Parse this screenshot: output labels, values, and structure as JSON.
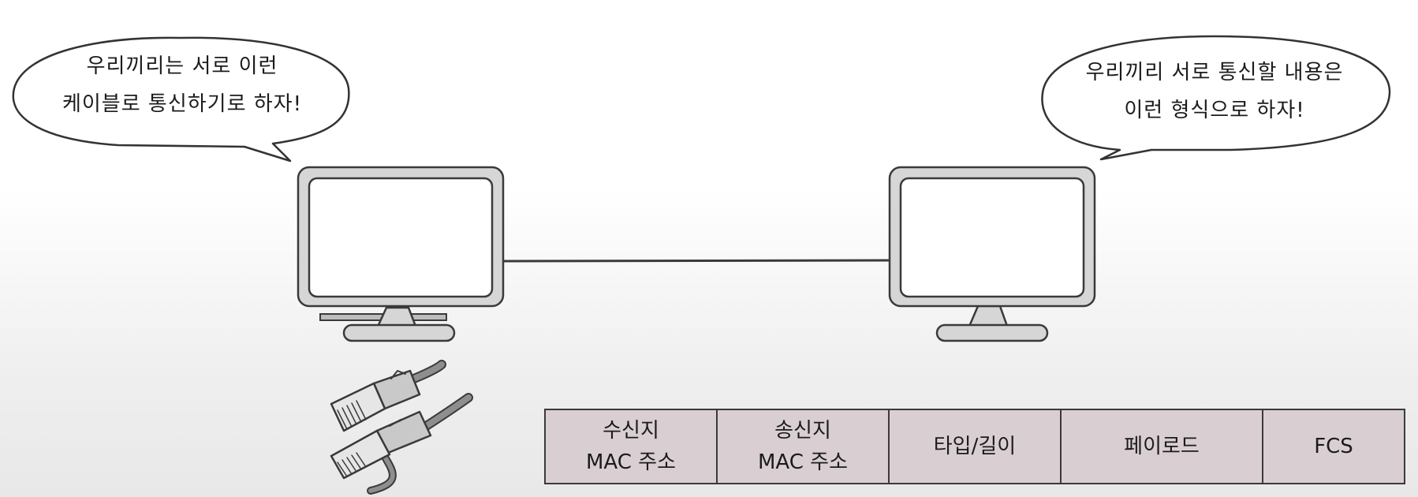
{
  "speech": {
    "left": {
      "line1": "우리끼리는 서로 이런",
      "line2": "케이블로 통신하기로 하자!"
    },
    "right": {
      "line1": "우리끼리 서로 통신할 내용은",
      "line2": "이런 형식으로 하자!"
    }
  },
  "frame": {
    "fields": [
      {
        "line1": "수신지",
        "line2": "MAC 주소"
      },
      {
        "line1": "송신지",
        "line2": "MAC 주소"
      },
      {
        "line1": "타입/길이",
        "line2": ""
      },
      {
        "line1": "페이로드",
        "line2": ""
      },
      {
        "line1": "FCS",
        "line2": ""
      }
    ],
    "fill_color": "#d9cfd3"
  },
  "icons": [
    "monitor-icon",
    "monitor-icon",
    "ethernet-cable-icon"
  ]
}
